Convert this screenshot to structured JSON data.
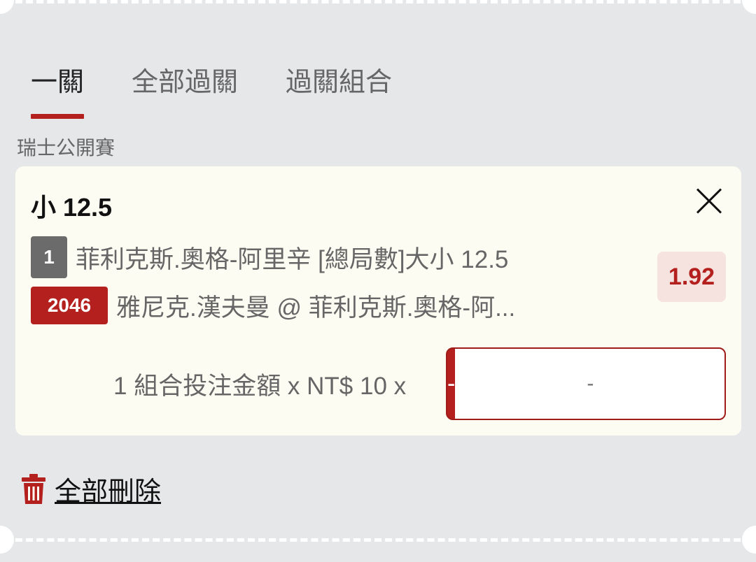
{
  "tabs": [
    {
      "label": "一關",
      "active": true
    },
    {
      "label": "全部過關",
      "active": false
    },
    {
      "label": "過關組合",
      "active": false
    }
  ],
  "league": "瑞士公開賽",
  "bet": {
    "title": "小 12.5",
    "selection_number": "1",
    "selection_text": "菲利克斯.奧格-阿里辛 [總局數]大小 12.5",
    "match_code": "2046",
    "match_text": "雅尼克.漢夫曼 @ 菲利克斯.奧格-阿...",
    "odds": "1.92",
    "stake_label": "1 組合投注金額 x NT$ 10 x",
    "stepper": {
      "minus": "-",
      "value": "-",
      "plus": "+"
    }
  },
  "delete_all_label": "全部刪除",
  "icons": {
    "close": "close-icon",
    "trash": "trash-icon"
  },
  "colors": {
    "accent": "#b3201d",
    "background": "#e6e7e9",
    "card": "#fdfcf3",
    "odds_bg": "#f6e2de"
  }
}
